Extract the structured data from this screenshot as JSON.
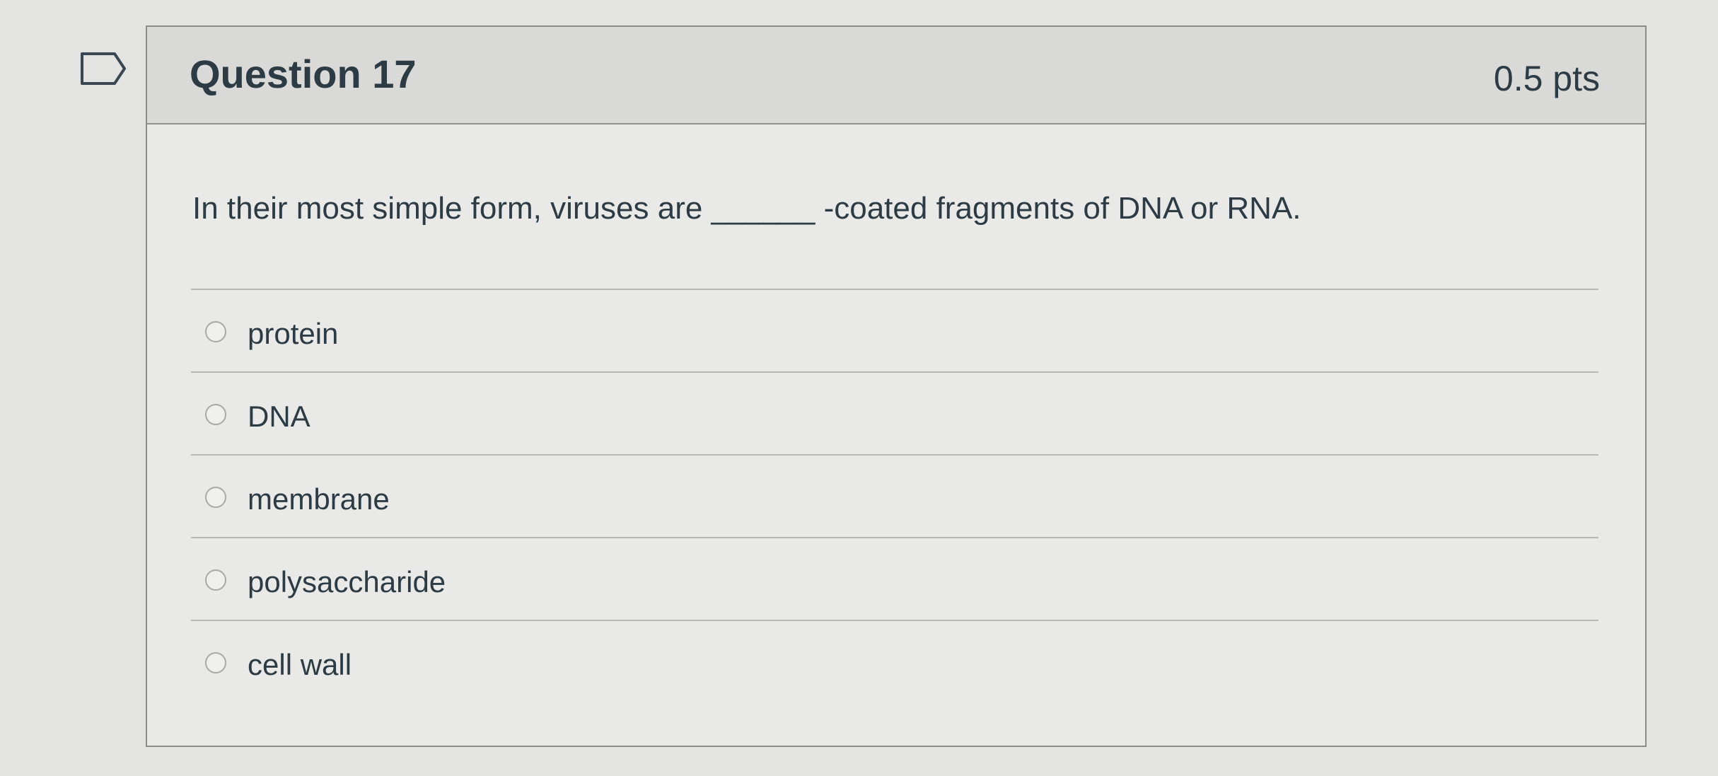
{
  "question": {
    "title": "Question 17",
    "points": "0.5 pts",
    "text": "In their most simple form, viruses are ______ -coated fragments of DNA or RNA.",
    "flag_icon": "flag-icon"
  },
  "answers": [
    {
      "label": "protein",
      "selected": false
    },
    {
      "label": "DNA",
      "selected": false
    },
    {
      "label": "membrane",
      "selected": false
    },
    {
      "label": "polysaccharide",
      "selected": false
    },
    {
      "label": "cell wall",
      "selected": false
    }
  ],
  "colors": {
    "text": "#2d3b45",
    "header_bg": "#d9d9d7",
    "page_bg": "#e3e3e1"
  }
}
